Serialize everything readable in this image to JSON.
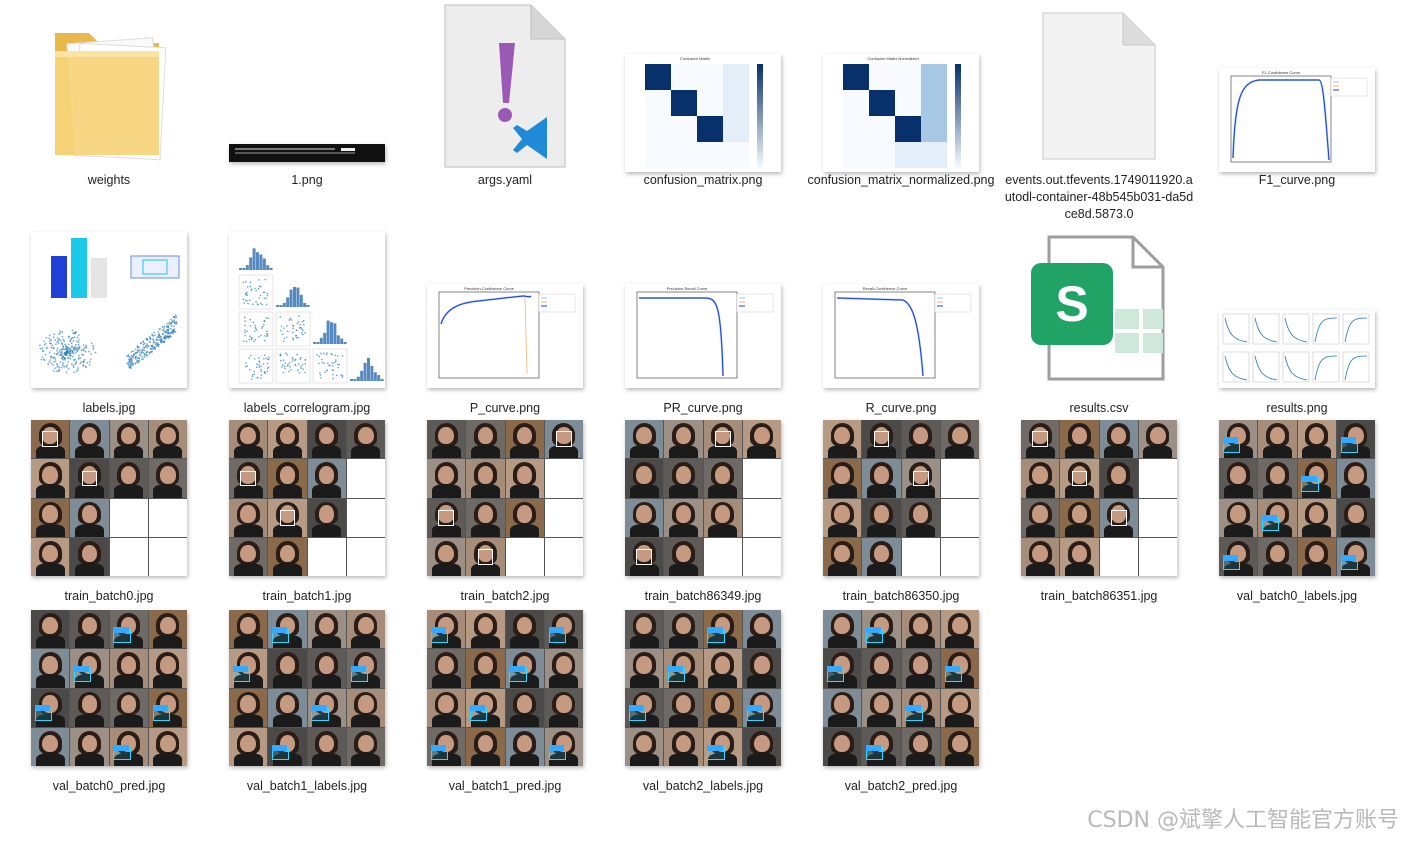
{
  "files": [
    {
      "name": "weights",
      "type": "folder"
    },
    {
      "name": "1.png",
      "type": "terminal"
    },
    {
      "name": "args.yaml",
      "type": "yaml"
    },
    {
      "name": "confusion_matrix.png",
      "type": "heatmap",
      "image_title": "Confusion Matrix"
    },
    {
      "name": "confusion_matrix_normalized.png",
      "type": "heatmap",
      "image_title": "Confusion Matrix Normalized"
    },
    {
      "name": "events.out.tfevents.1749011920.autodl-container-48b545b031-da5dce8d.5873.0",
      "type": "blank"
    },
    {
      "name": "F1_curve.png",
      "type": "curve",
      "image_title": "F1-Confidence Curve"
    },
    {
      "name": "labels.jpg",
      "type": "labels"
    },
    {
      "name": "labels_correlogram.jpg",
      "type": "correlogram"
    },
    {
      "name": "P_curve.png",
      "type": "curve",
      "image_title": "Precision-Confidence Curve"
    },
    {
      "name": "PR_curve.png",
      "type": "curve",
      "image_title": "Precision-Recall Curve"
    },
    {
      "name": "R_curve.png",
      "type": "curve",
      "image_title": "Recall-Confidence Curve"
    },
    {
      "name": "results.csv",
      "type": "csv"
    },
    {
      "name": "results.png",
      "type": "results"
    },
    {
      "name": "train_batch0.jpg",
      "type": "mosaic"
    },
    {
      "name": "train_batch1.jpg",
      "type": "mosaic"
    },
    {
      "name": "train_batch2.jpg",
      "type": "mosaic"
    },
    {
      "name": "train_batch86349.jpg",
      "type": "mosaic"
    },
    {
      "name": "train_batch86350.jpg",
      "type": "mosaic"
    },
    {
      "name": "train_batch86351.jpg",
      "type": "mosaic"
    },
    {
      "name": "val_batch0_labels.jpg",
      "type": "mosaic"
    },
    {
      "name": "val_batch0_pred.jpg",
      "type": "mosaic"
    },
    {
      "name": "val_batch1_labels.jpg",
      "type": "mosaic"
    },
    {
      "name": "val_batch1_pred.jpg",
      "type": "mosaic"
    },
    {
      "name": "val_batch2_labels.jpg",
      "type": "mosaic"
    },
    {
      "name": "val_batch2_pred.jpg",
      "type": "mosaic"
    }
  ],
  "icons": {
    "folder": "folder-icon",
    "yaml": "yaml-file-icon",
    "csv": "csv-spreadsheet-icon",
    "blank": "blank-file-icon"
  },
  "colors": {
    "folder": "#f6d27a",
    "yaml_bang": "#9b59b6",
    "vscode": "#1f8ad8",
    "csv": "#21a366",
    "heat": "#08306b",
    "curve": "#1f3fd6"
  },
  "watermark": "CSDN @斌擎人工智能官方账号"
}
